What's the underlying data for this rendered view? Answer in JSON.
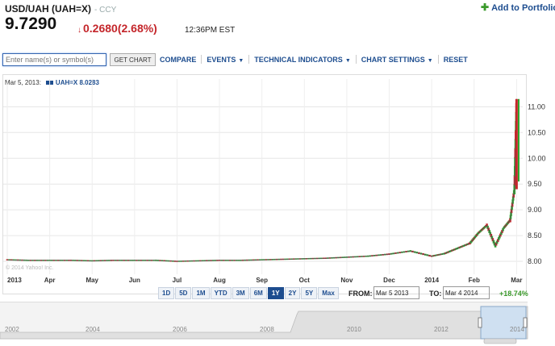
{
  "header": {
    "title": "USD/UAH (UAH=X)",
    "exchange": "- CCY",
    "price": "9.7290",
    "change_arrow": "↓",
    "change": "0.2680(2.68%)",
    "time": "12:36PM EST",
    "add_portfolio": "Add to Portfolio"
  },
  "toolbar": {
    "search_placeholder": "Enter name(s) or symbol(s)",
    "get_chart": "GET CHART",
    "compare": "COMPARE",
    "events": "EVENTS",
    "technical": "TECHNICAL INDICATORS",
    "settings": "CHART SETTINGS",
    "reset": "RESET"
  },
  "legend": {
    "date": "Mar 5, 2013:",
    "symbol": "UAH=X 8.0283"
  },
  "copyright": "© 2014 Yahoo! Inc.",
  "ranges": [
    "1D",
    "5D",
    "1M",
    "YTD",
    "3M",
    "6M",
    "1Y",
    "2Y",
    "5Y",
    "Max"
  ],
  "active_range": "1Y",
  "from_label": "FROM:",
  "from_value": "Mar 5 2013",
  "to_label": "TO:",
  "to_value": "Mar 4 2014",
  "pct_change": "+18.74%",
  "navigator_years": [
    "2002",
    "2004",
    "2006",
    "2008",
    "2010",
    "2012",
    "2014"
  ],
  "colors": {
    "up": "#2fa52f",
    "down": "#c4262b",
    "accent": "#1d4d8f"
  },
  "chart_data": {
    "type": "line",
    "x_ticks": [
      "2013",
      "Apr",
      "May",
      "Jun",
      "Jul",
      "Aug",
      "Sep",
      "Oct",
      "Nov",
      "Dec",
      "2014",
      "Feb",
      "Mar"
    ],
    "y_ticks": [
      "8.00",
      "8.50",
      "9.00",
      "9.50",
      "10.00",
      "10.50",
      "11.00"
    ],
    "ylim": [
      7.75,
      11.35
    ],
    "grid": true,
    "series": [
      {
        "name": "UAH=X",
        "x": [
          0,
          0.5,
          1,
          1.5,
          2,
          2.5,
          3,
          3.5,
          4,
          4.5,
          5,
          5.5,
          6,
          6.5,
          7,
          7.5,
          8,
          8.5,
          9,
          9.5,
          10,
          10.3,
          10.6,
          10.9,
          11.1,
          11.3,
          11.5,
          11.7,
          11.85,
          11.95,
          12.0
        ],
        "y": [
          8.03,
          8.02,
          8.02,
          8.02,
          8.01,
          8.02,
          8.02,
          8.02,
          8.0,
          8.01,
          8.02,
          8.02,
          8.03,
          8.04,
          8.05,
          8.06,
          8.08,
          8.1,
          8.14,
          8.2,
          8.1,
          8.15,
          8.25,
          8.35,
          8.55,
          8.7,
          8.3,
          8.65,
          8.8,
          9.4,
          11.15
        ]
      },
      {
        "name": "current",
        "x": [
          12.0,
          12.05
        ],
        "y": [
          11.15,
          9.55
        ]
      }
    ]
  }
}
